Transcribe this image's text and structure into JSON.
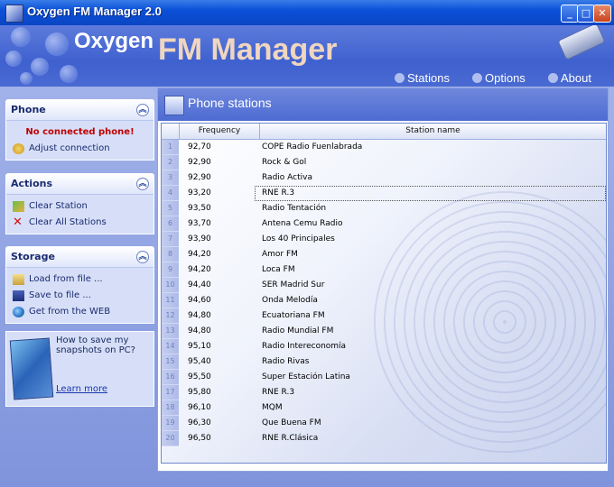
{
  "window": {
    "title": "Oxygen FM Manager 2.0",
    "controls": {
      "minimize": "_",
      "maximize": "□",
      "close": "✕"
    }
  },
  "header": {
    "logo_oxygen": "Oxygen",
    "logo_fm": "FM Manager",
    "menu": [
      {
        "label": "Stations",
        "icon": "antenna-icon"
      },
      {
        "label": "Options",
        "icon": "gear-icon"
      },
      {
        "label": "About",
        "icon": "info-icon"
      }
    ]
  },
  "sidebar": {
    "phone": {
      "title": "Phone",
      "status": "No connected phone!",
      "items": [
        {
          "label": "Adjust connection",
          "icon": "connection-icon"
        }
      ]
    },
    "actions": {
      "title": "Actions",
      "items": [
        {
          "label": "Clear Station",
          "icon": "eraser-icon"
        },
        {
          "label": "Clear All Stations",
          "icon": "delete-x-icon"
        }
      ]
    },
    "storage": {
      "title": "Storage",
      "items": [
        {
          "label": "Load from file ...",
          "icon": "open-file-icon"
        },
        {
          "label": "Save to file ...",
          "icon": "save-disk-icon"
        },
        {
          "label": "Get from the WEB",
          "icon": "globe-icon"
        }
      ]
    },
    "ad": {
      "text": "How to save my snapshots on PC?",
      "link": "Learn more"
    }
  },
  "main": {
    "title": "Phone stations",
    "columns": {
      "frequency": "Frequency",
      "station": "Station name"
    },
    "selected_row": 4,
    "rows": [
      {
        "n": "1",
        "freq": "92,70",
        "name": "COPE Radio Fuenlabrada"
      },
      {
        "n": "2",
        "freq": "92,90",
        "name": "Rock & Gol"
      },
      {
        "n": "3",
        "freq": "92,90",
        "name": "Radio Activa"
      },
      {
        "n": "4",
        "freq": "93,20",
        "name": "RNE R.3"
      },
      {
        "n": "5",
        "freq": "93,50",
        "name": "Radio Tentación"
      },
      {
        "n": "6",
        "freq": "93,70",
        "name": "Antena Cemu Radio"
      },
      {
        "n": "7",
        "freq": "93,90",
        "name": "Los 40 Principales"
      },
      {
        "n": "8",
        "freq": "94,20",
        "name": "Amor FM"
      },
      {
        "n": "9",
        "freq": "94,20",
        "name": "Loca FM"
      },
      {
        "n": "10",
        "freq": "94,40",
        "name": "SER Madrid Sur"
      },
      {
        "n": "11",
        "freq": "94,60",
        "name": "Onda Melodía"
      },
      {
        "n": "12",
        "freq": "94,80",
        "name": "Ecuatoriana FM"
      },
      {
        "n": "13",
        "freq": "94,80",
        "name": "Radio Mundial FM"
      },
      {
        "n": "14",
        "freq": "95,10",
        "name": "Radio Intereconomía"
      },
      {
        "n": "15",
        "freq": "95,40",
        "name": "Radio Rivas"
      },
      {
        "n": "16",
        "freq": "95,50",
        "name": "Super Estación Latina"
      },
      {
        "n": "17",
        "freq": "95,80",
        "name": "RNE R.3"
      },
      {
        "n": "18",
        "freq": "96,10",
        "name": "MQM"
      },
      {
        "n": "19",
        "freq": "96,30",
        "name": "Que Buena FM"
      },
      {
        "n": "20",
        "freq": "96,50",
        "name": "RNE R.Clásica"
      }
    ]
  }
}
